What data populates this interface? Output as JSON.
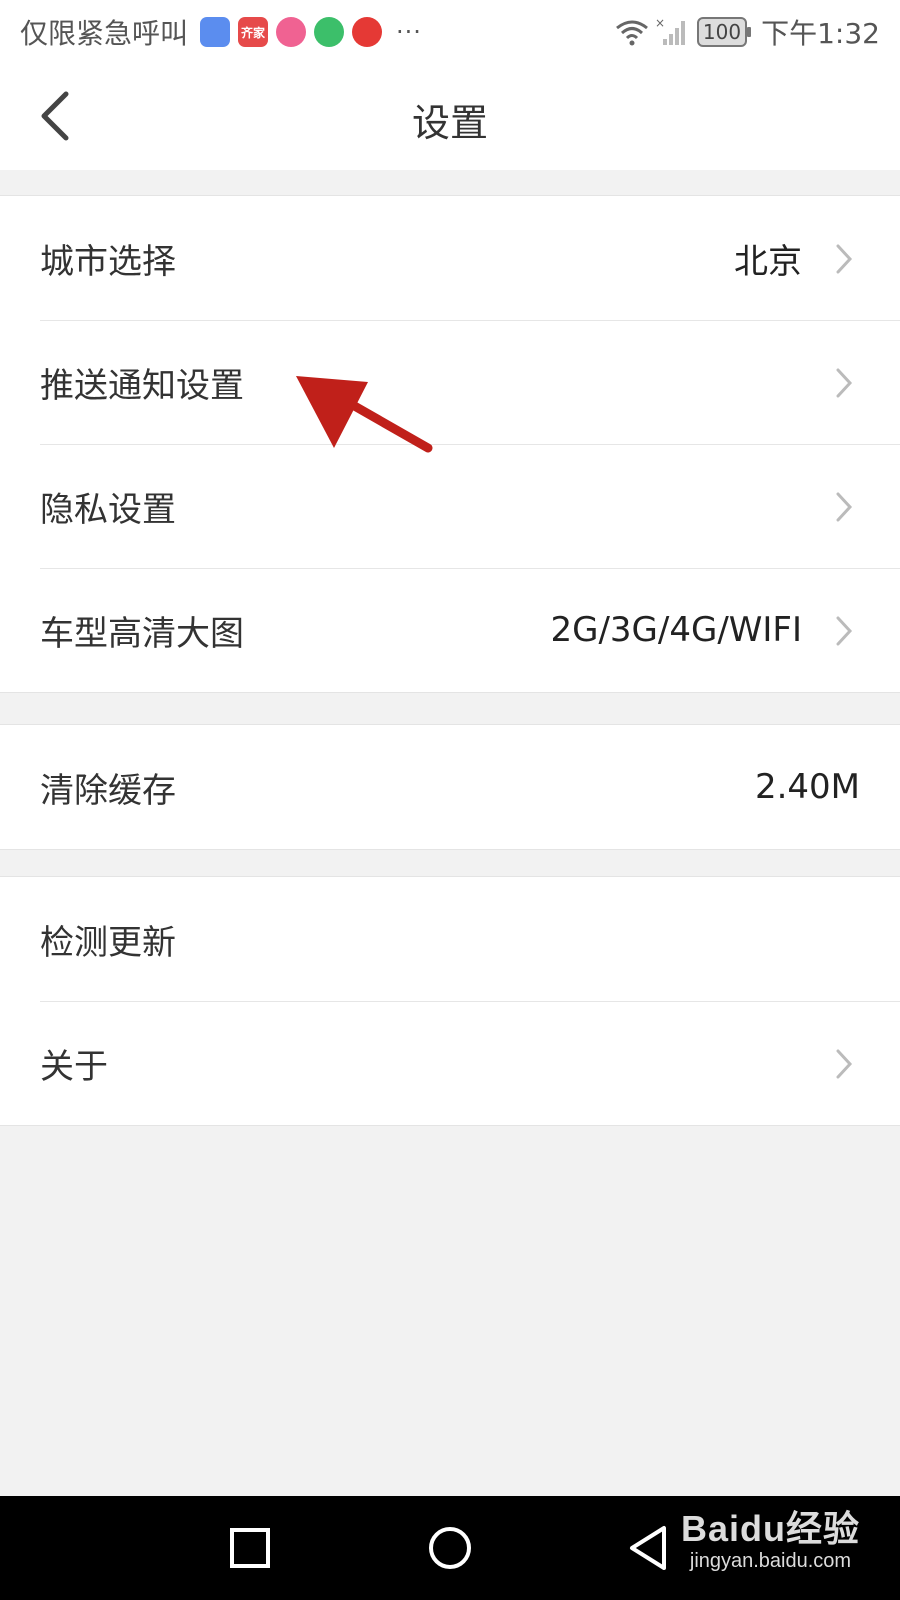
{
  "status_bar": {
    "carrier_text": "仅限紧急呼叫",
    "notification_icons": [
      {
        "name": "app-gift-icon",
        "color": "#5b8def"
      },
      {
        "name": "app-qijia-icon",
        "color": "#e64a4a",
        "label": "齐家"
      },
      {
        "name": "app-pink-icon",
        "color": "#f06292"
      },
      {
        "name": "app-tudou-icon",
        "color": "#3cbf6a"
      },
      {
        "name": "app-tmall-icon",
        "color": "#e53935"
      }
    ],
    "more_indicator": "···",
    "battery": "100",
    "time": "下午1:32"
  },
  "header": {
    "title": "设置",
    "back_icon": "chevron-left-icon"
  },
  "groups": [
    {
      "items": [
        {
          "label": "城市选择",
          "value": "北京",
          "chevron": true
        },
        {
          "label": "推送通知设置",
          "value": "",
          "chevron": true
        },
        {
          "label": "隐私设置",
          "value": "",
          "chevron": true
        },
        {
          "label": "车型高清大图",
          "value": "2G/3G/4G/WIFI",
          "chevron": true
        }
      ]
    },
    {
      "items": [
        {
          "label": "清除缓存",
          "value": "2.40M",
          "chevron": false
        }
      ]
    },
    {
      "items": [
        {
          "label": "检测更新",
          "value": "",
          "chevron": false
        },
        {
          "label": "关于",
          "value": "",
          "chevron": true
        }
      ]
    }
  ],
  "annotation": {
    "color": "#c0201a"
  },
  "system_nav": {
    "buttons": [
      "recents-square-icon",
      "home-circle-icon",
      "back-triangle-icon"
    ]
  },
  "watermark": {
    "main": "Baidu经验",
    "sub": "jingyan.baidu.com"
  }
}
